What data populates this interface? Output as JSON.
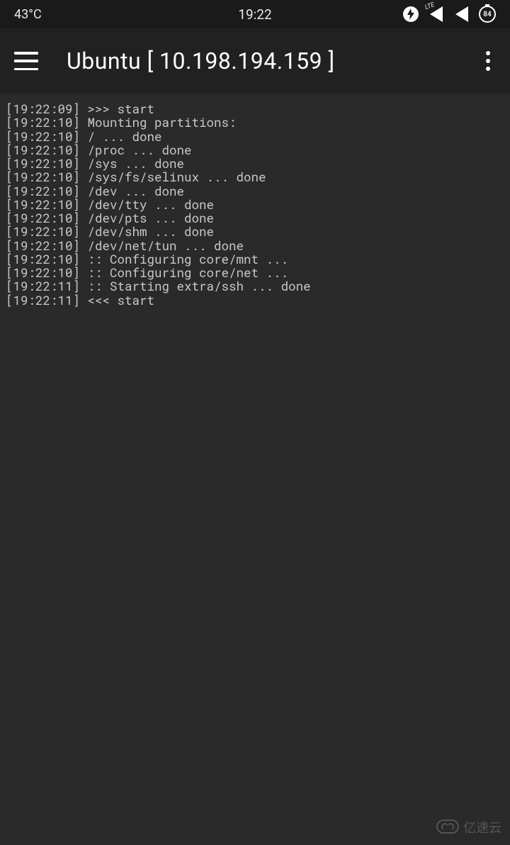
{
  "status_bar": {
    "temperature": "43°C",
    "time": "19:22",
    "network_type": "LTE",
    "battery_percent": "84"
  },
  "app_bar": {
    "title": "Ubuntu  [ 10.198.194.159 ]"
  },
  "terminal": {
    "lines": [
      "[19:22:09] >>> start",
      "[19:22:10] Mounting partitions:",
      "[19:22:10] / ... done",
      "[19:22:10] /proc ... done",
      "[19:22:10] /sys ... done",
      "[19:22:10] /sys/fs/selinux ... done",
      "[19:22:10] /dev ... done",
      "[19:22:10] /dev/tty ... done",
      "[19:22:10] /dev/pts ... done",
      "[19:22:10] /dev/shm ... done",
      "[19:22:10] /dev/net/tun ... done",
      "[19:22:10] :: Configuring core/mnt ...",
      "[19:22:10] :: Configuring core/net ...",
      "[19:22:11] :: Starting extra/ssh ... done",
      "[19:22:11] <<< start"
    ]
  },
  "watermark": {
    "text": "亿速云"
  }
}
